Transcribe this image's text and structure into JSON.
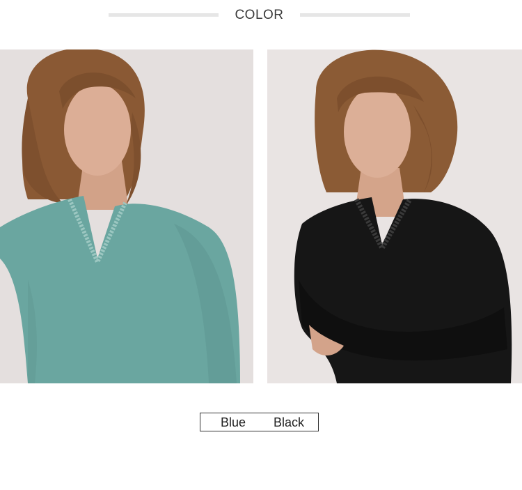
{
  "header": {
    "title": "COLOR"
  },
  "variants": [
    {
      "label": "Blue",
      "color": "#6aa6a0"
    },
    {
      "label": "Black",
      "color": "#161616"
    }
  ],
  "photos": {
    "blue": {
      "subject": "model wearing blue v-neck knit top with lace trim"
    },
    "black": {
      "subject": "model wearing black v-neck knit top with lace trim"
    }
  },
  "colors": {
    "hair": "#8a5a34",
    "skin": "#d8ab93",
    "background": "#e6e1e0"
  }
}
